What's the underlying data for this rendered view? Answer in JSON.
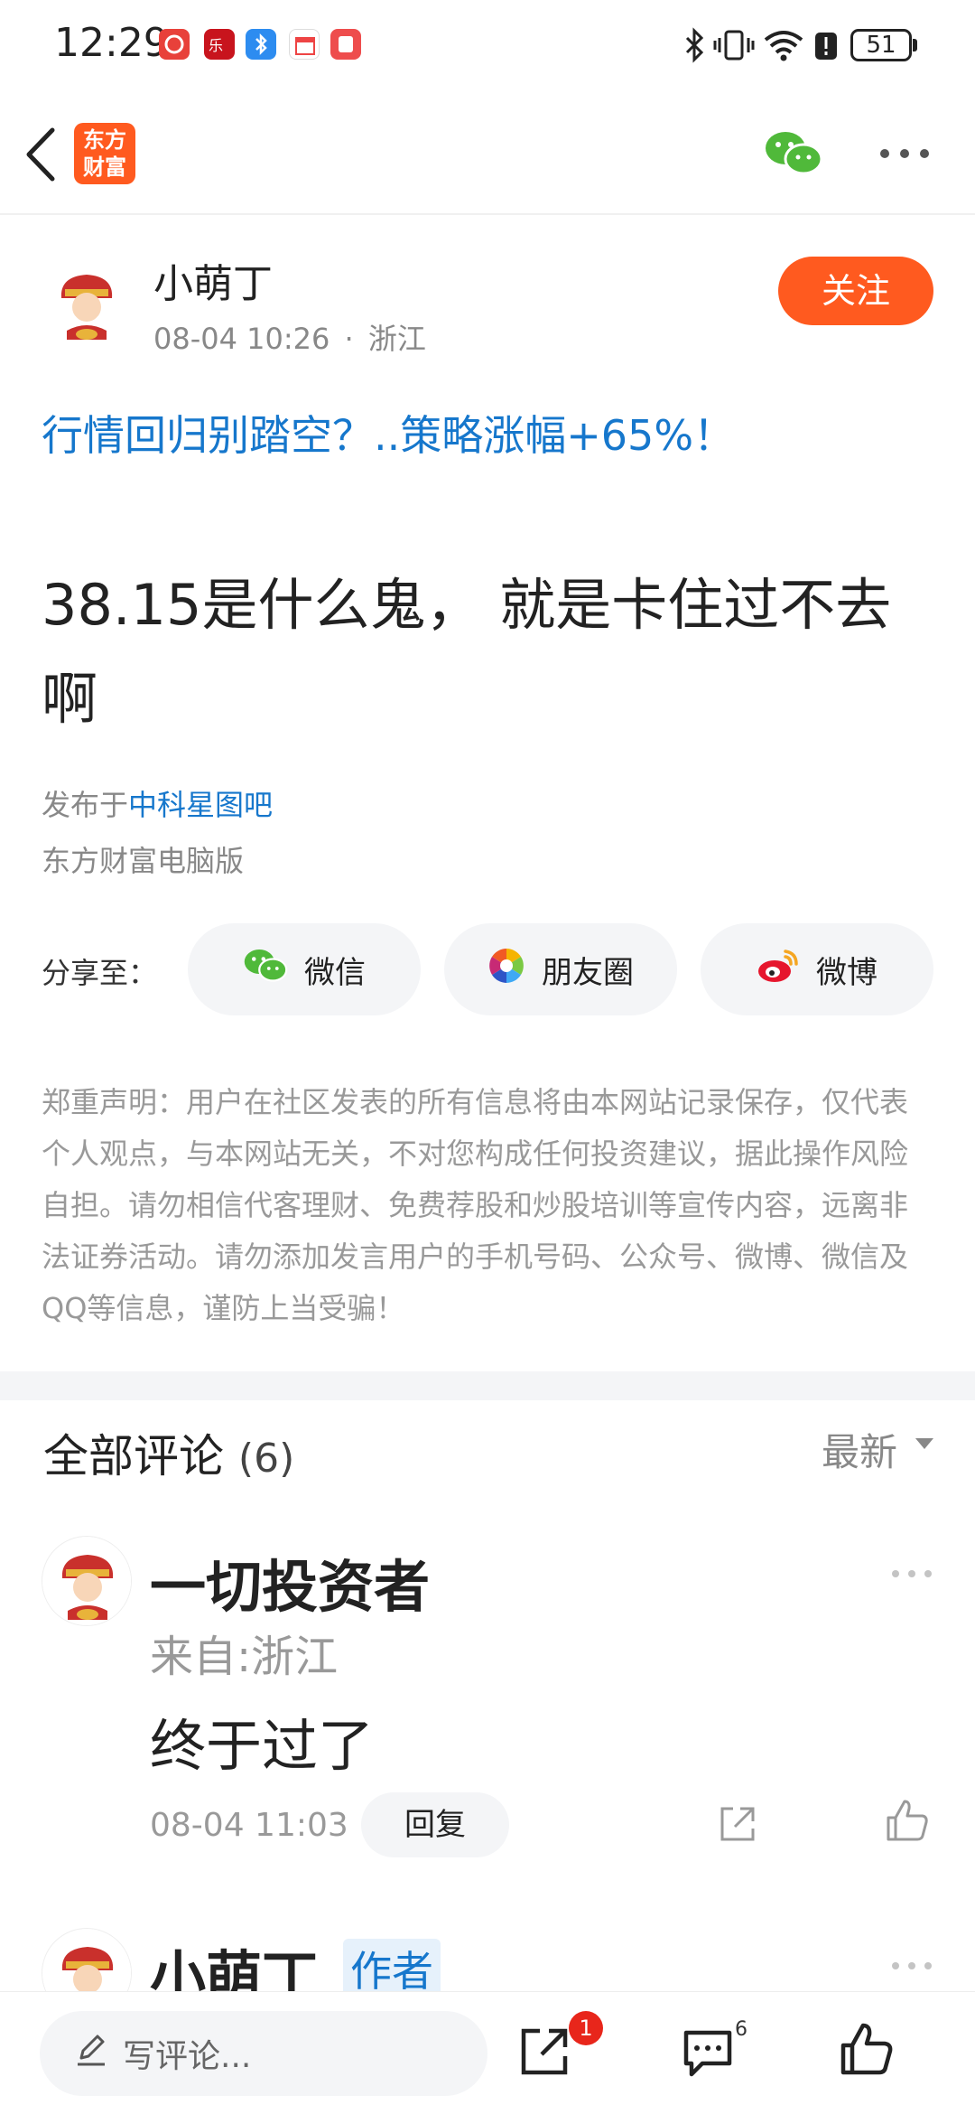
{
  "status_bar": {
    "time": "12:29",
    "battery": "51",
    "app_icons": [
      "app-icon-1",
      "app-icon-2",
      "bluetooth-app-icon",
      "calendar-app-icon",
      "app-icon-5"
    ],
    "right_icons": [
      "bluetooth-icon",
      "vibrate-icon",
      "wifi-icon",
      "alert-icon"
    ]
  },
  "nav": {
    "logo_text_line1": "东方",
    "logo_text_line2": "财富",
    "back_icon": "back-arrow-icon",
    "wechat_icon": "wechat-icon",
    "more_icon": "more-icon"
  },
  "author": {
    "name": "小萌丁",
    "date": "08-04 10:26",
    "separator": "·",
    "location": "浙江",
    "follow_label": "关注"
  },
  "post": {
    "title": "行情回归别踏空？..策略涨幅+65%！",
    "body": "38.15是什么鬼，  就是卡住过不去啊",
    "published_prefix": "发布于",
    "published_bar": "中科星图吧",
    "source": "东方财富电脑版"
  },
  "share": {
    "label": "分享至：",
    "buttons": [
      {
        "label": "微信",
        "icon": "wechat-icon"
      },
      {
        "label": "朋友圈",
        "icon": "moments-icon"
      },
      {
        "label": "微博",
        "icon": "weibo-icon"
      }
    ]
  },
  "disclaimer": "郑重声明：用户在社区发表的所有信息将由本网站记录保存，仅代表个人观点，与本网站无关，不对您构成任何投资建议，据此操作风险自担。请勿相信代客理财、免费荐股和炒股培训等宣传内容，远离非法证券活动。请勿添加发言用户的手机号码、公众号、微博、微信及QQ等信息，谨防上当受骗！",
  "comments": {
    "title": "全部评论",
    "count": "(6)",
    "sort_label": "最新",
    "items": [
      {
        "name": "一切投资者",
        "location": "来自:浙江",
        "text": "终于过了",
        "time": "08-04 11:03",
        "reply_label": "回复"
      },
      {
        "name": "小萌丁",
        "author_tag": "作者"
      }
    ]
  },
  "bottom_bar": {
    "input_placeholder": "写评论...",
    "share_badge": "1",
    "comment_count": "6"
  },
  "colors": {
    "brand_orange": "#ff5a1f",
    "link_blue": "#1677cc",
    "badge_red": "#e8261b"
  }
}
